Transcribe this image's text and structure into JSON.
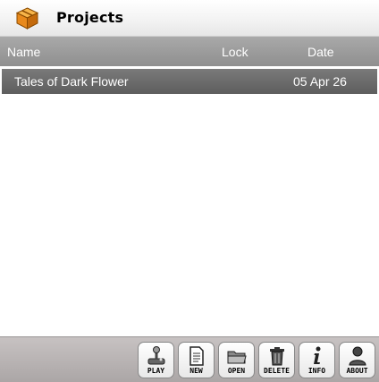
{
  "header": {
    "title": "Projects",
    "icon": "box-icon"
  },
  "table": {
    "columns": {
      "name": "Name",
      "lock": "Lock",
      "date": "Date"
    },
    "rows": [
      {
        "name": "Tales of Dark Flower",
        "lock": "",
        "date": "05 Apr 26"
      }
    ]
  },
  "toolbar": {
    "play": "PLAY",
    "new": "NEW",
    "open": "OPEN",
    "delete": "DELETE",
    "info": "INFO",
    "about": "ABOUT"
  },
  "colors": {
    "header_bg": "#9e9e9e",
    "row_selected": "#6b6b6b",
    "toolbar_bg": "#bdb8b8",
    "box_orange": "#e8891c"
  }
}
